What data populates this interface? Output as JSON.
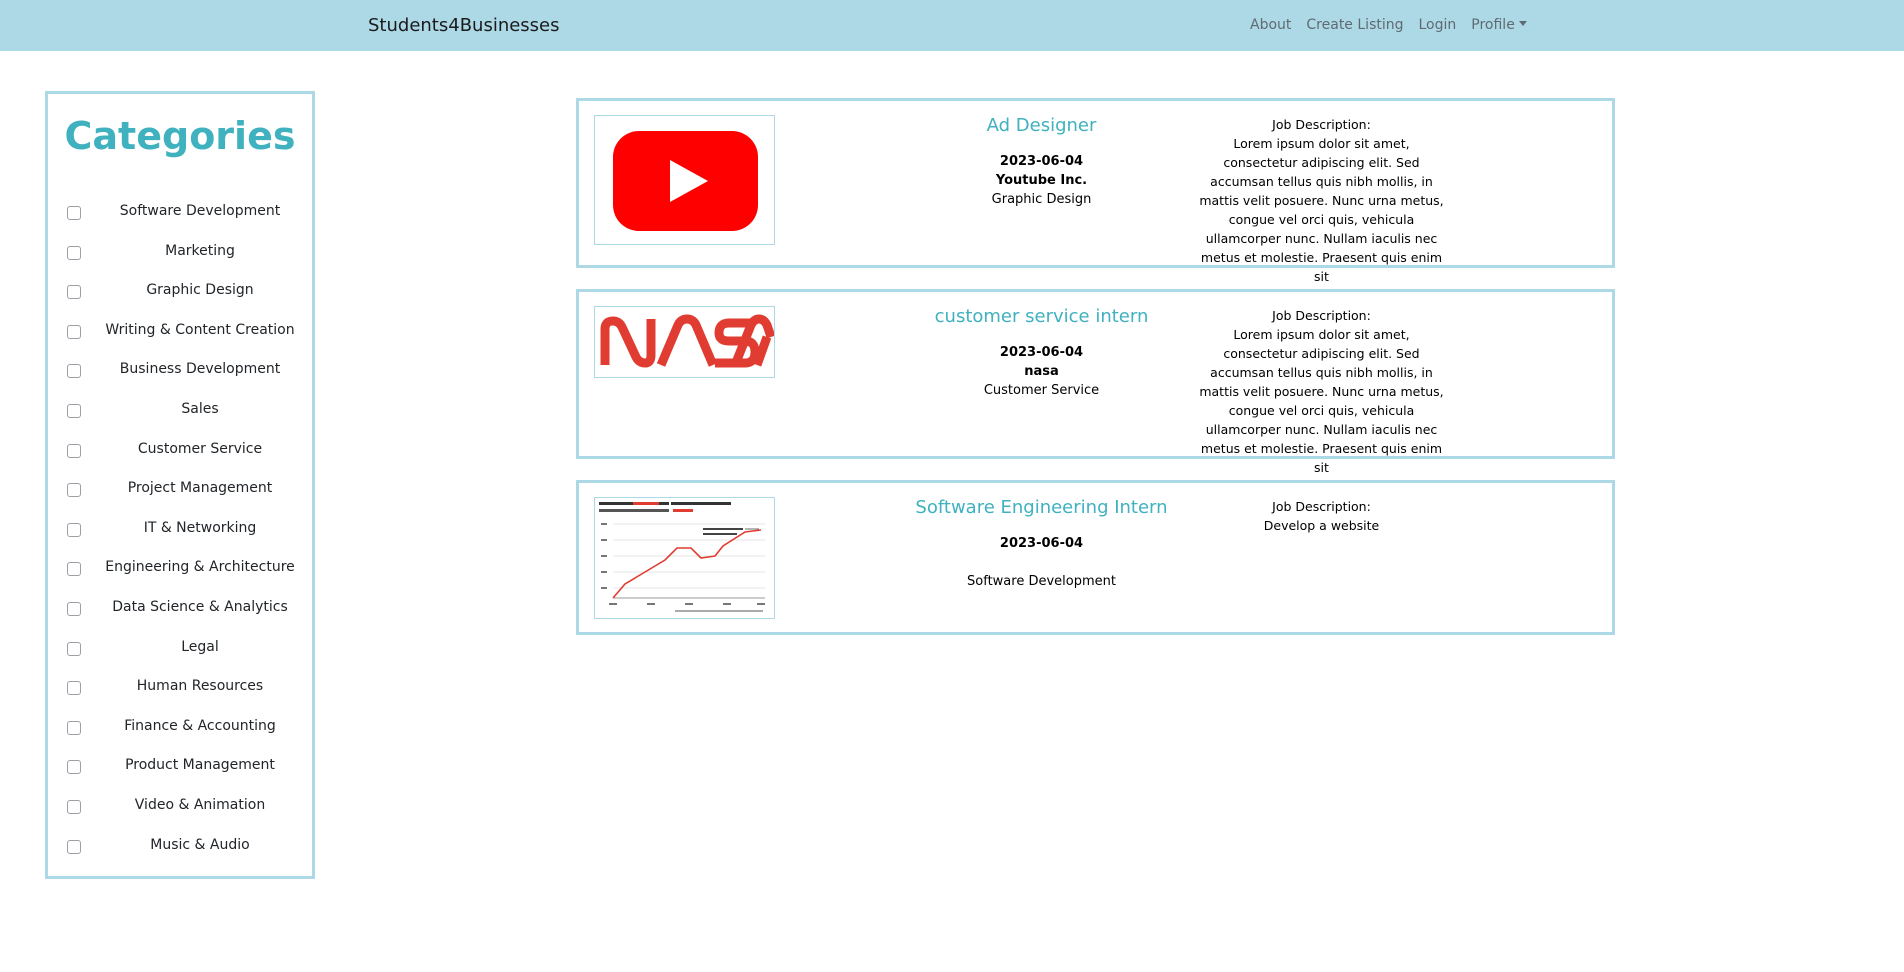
{
  "navbar": {
    "brand": "Students4Businesses",
    "links": [
      "About",
      "Create Listing",
      "Login",
      "Profile"
    ]
  },
  "sidebar": {
    "title": "Categories",
    "categories": [
      "Software Development",
      "Marketing",
      "Graphic Design",
      "Writing & Content Creation",
      "Business Development",
      "Sales",
      "Customer Service",
      "Project Management",
      "IT & Networking",
      "Engineering & Architecture",
      "Data Science & Analytics",
      "Legal",
      "Human Resources",
      "Finance & Accounting",
      "Product Management",
      "Video & Animation",
      "Music & Audio"
    ]
  },
  "listings": [
    {
      "title": "Ad Designer",
      "date": "2023-06-04",
      "company": "Youtube Inc.",
      "category": "Graphic Design",
      "description_label": "Job Description:",
      "description": "Lorem ipsum dolor sit amet, consectetur adipiscing elit. Sed accumsan tellus quis nibh mollis, in mattis velit posuere. Nunc urna metus, congue vel orci quis, vehicula ullamcorper nunc. Nullam iaculis nec metus et molestie. Praesent quis enim sit",
      "logo": "youtube-logo"
    },
    {
      "title": "customer service intern",
      "date": "2023-06-04",
      "company": "nasa",
      "category": "Customer Service",
      "description_label": "Job Description:",
      "description": "Lorem ipsum dolor sit amet, consectetur adipiscing elit. Sed accumsan tellus quis nibh mollis, in mattis velit posuere. Nunc urna metus, congue vel orci quis, vehicula ullamcorper nunc. Nullam iaculis nec metus et molestie. Praesent quis enim sit",
      "logo": "nasa-logo"
    },
    {
      "title": "Software Engineering Intern",
      "date": "2023-06-04",
      "company": "",
      "category": "Software Development",
      "description_label": "Job Description:",
      "description": "Develop a website",
      "logo": "chart-thumbnail"
    }
  ],
  "colors": {
    "navbar_bg": "#add8e6",
    "accent": "#3fb1bf",
    "youtube_red": "#ff0000",
    "nasa_red": "#e03c31"
  }
}
